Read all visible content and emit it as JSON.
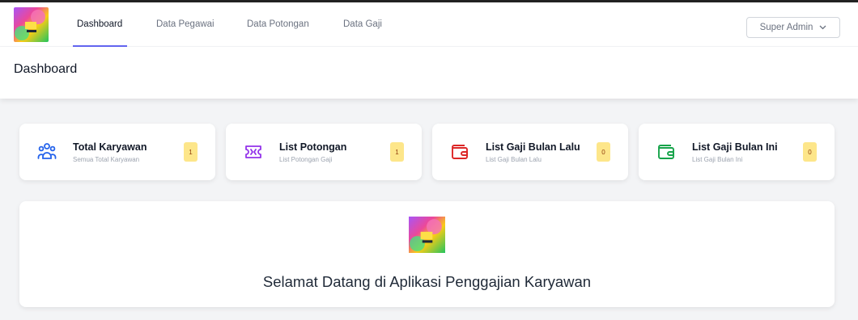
{
  "nav": {
    "links": [
      "Dashboard",
      "Data Pegawai",
      "Data Potongan",
      "Data Gaji"
    ],
    "user_label": "Super Admin"
  },
  "header": {
    "title": "Dashboard"
  },
  "cards": [
    {
      "title": "Total Karyawan",
      "subtitle": "Semua Total Karyawan",
      "badge": "1",
      "icon": "users-icon",
      "color": "#2563eb"
    },
    {
      "title": "List Potongan",
      "subtitle": "List Potongan Gaji",
      "badge": "1",
      "icon": "ticket-icon",
      "color": "#9333ea"
    },
    {
      "title": "List Gaji Bulan Lalu",
      "subtitle": "List Gaji Bulan Lalu",
      "badge": "0",
      "icon": "wallet-icon",
      "color": "#dc2626"
    },
    {
      "title": "List Gaji Bulan Ini",
      "subtitle": "List Gaji Bulan Ini",
      "badge": "0",
      "icon": "wallet-icon",
      "color": "#16a34a"
    }
  ],
  "welcome": {
    "text": "Selamat Datang di Aplikasi Penggajian Karyawan"
  }
}
